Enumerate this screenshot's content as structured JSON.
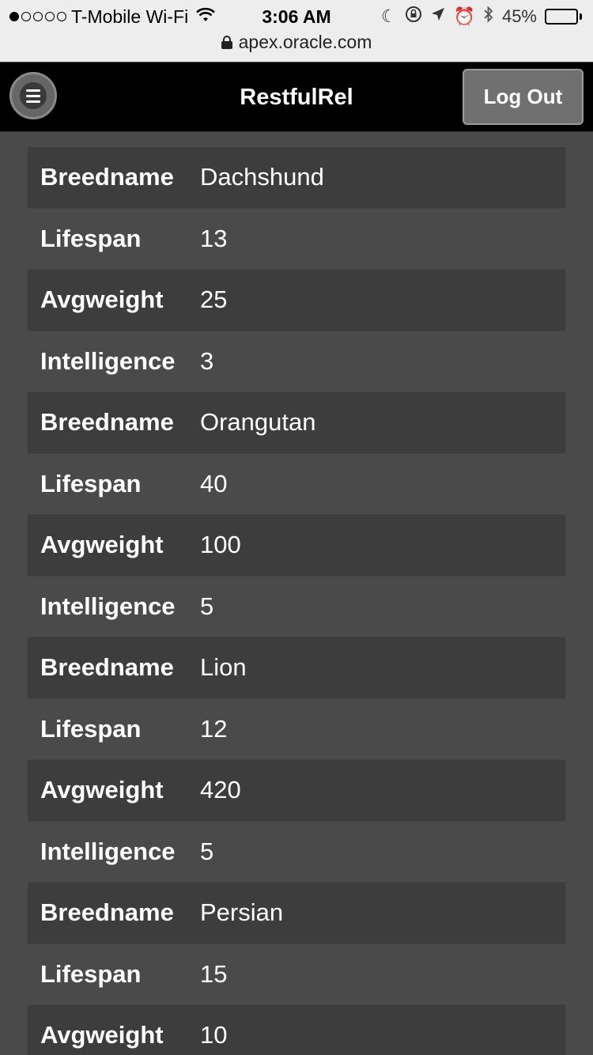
{
  "status_bar": {
    "carrier": "T-Mobile Wi-Fi",
    "time": "3:06 AM",
    "battery": "45%",
    "battery_level": 0.45,
    "url": "apex.oracle.com"
  },
  "header": {
    "title": "RestfulRel",
    "logout_label": "Log Out"
  },
  "records": [
    {
      "rows": [
        {
          "label": "Breedname",
          "value": "Dachshund"
        },
        {
          "label": "Lifespan",
          "value": "13"
        },
        {
          "label": "Avgweight",
          "value": "25"
        },
        {
          "label": "Intelligence",
          "value": "3"
        }
      ]
    },
    {
      "rows": [
        {
          "label": "Breedname",
          "value": "Orangutan"
        },
        {
          "label": "Lifespan",
          "value": "40"
        },
        {
          "label": "Avgweight",
          "value": "100"
        },
        {
          "label": "Intelligence",
          "value": "5"
        }
      ]
    },
    {
      "rows": [
        {
          "label": "Breedname",
          "value": "Lion"
        },
        {
          "label": "Lifespan",
          "value": "12"
        },
        {
          "label": "Avgweight",
          "value": "420"
        },
        {
          "label": "Intelligence",
          "value": "5"
        }
      ]
    },
    {
      "rows": [
        {
          "label": "Breedname",
          "value": "Persian"
        },
        {
          "label": "Lifespan",
          "value": "15"
        },
        {
          "label": "Avgweight",
          "value": "10"
        }
      ]
    }
  ]
}
